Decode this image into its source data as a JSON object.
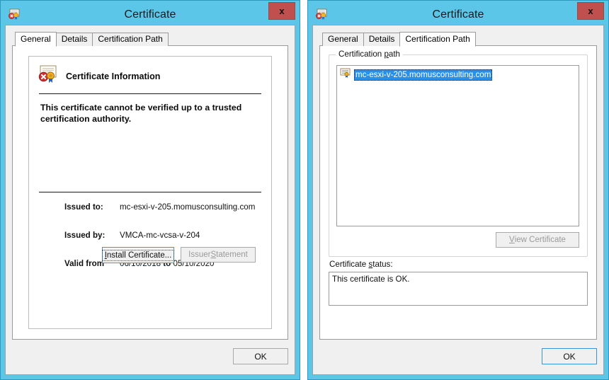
{
  "windows": {
    "left": {
      "title": "Certificate",
      "icon": "certificate-icon",
      "close_label": "x",
      "tabs": [
        {
          "label": "General",
          "active": true
        },
        {
          "label": "Details",
          "active": false
        },
        {
          "label": "Certification Path",
          "active": false
        }
      ],
      "general": {
        "heading": "Certificate Information",
        "message": "This certificate cannot be verified up to a trusted certification authority.",
        "fields": [
          {
            "label": "Issued to:",
            "value": "mc-esxi-v-205.momusconsulting.com"
          },
          {
            "label": "Issued by:",
            "value": "VMCA-mc-vcsa-v-204"
          }
        ],
        "validity": {
          "label": "Valid from",
          "from": "06/10/2018",
          "to_label": "to",
          "to": "05/10/2020"
        },
        "install_button": "Install Certificate...",
        "issuer_button_prefix": "Issuer ",
        "issuer_button_accel": "S",
        "issuer_button_suffix": "tatement",
        "install_accel": "I",
        "install_rest": "nstall Certificate..."
      },
      "ok_button": "OK"
    },
    "right": {
      "title": "Certificate",
      "icon": "certificate-icon",
      "close_label": "x",
      "tabs": [
        {
          "label": "General",
          "active": false
        },
        {
          "label": "Details",
          "active": false
        },
        {
          "label": "Certification Path",
          "active": true
        }
      ],
      "certification_path": {
        "group_label_prefix": "Certification ",
        "group_label_accel": "p",
        "group_label_suffix": "ath",
        "tree_items": [
          {
            "label": "mc-esxi-v-205.momusconsulting.com",
            "selected": true
          }
        ],
        "view_button_accel": "V",
        "view_button_rest": "iew Certificate",
        "status_label_prefix": "Certificate ",
        "status_label_accel": "s",
        "status_label_suffix": "tatus:",
        "status_text": "This certificate is OK."
      },
      "ok_button": "OK"
    }
  },
  "colors": {
    "window_chrome": "#5bc6e8",
    "dialog_face": "#f0f0f0",
    "close_red": "#c0504d",
    "selection_blue": "#2a8fe6",
    "focus_blue": "#3c93d6"
  }
}
